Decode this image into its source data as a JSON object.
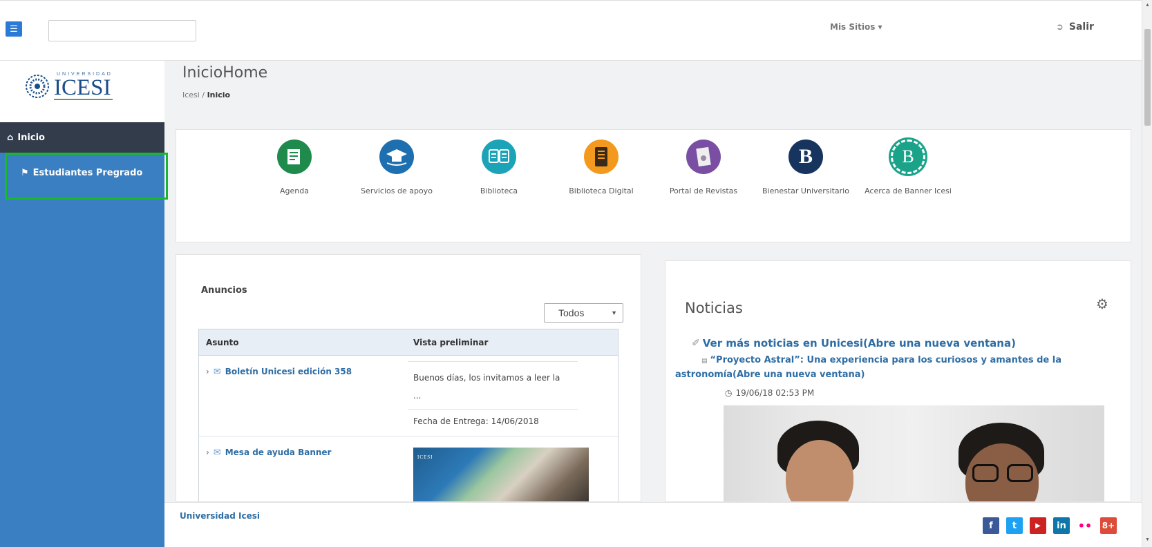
{
  "topbar": {
    "menu_icon": "hamburger-icon",
    "search_placeholder": "",
    "mis_sitios": "Mis Sitios ▾",
    "salir": "Salir"
  },
  "logo": {
    "sub": "UNIVERSIDAD",
    "main": "ICESI"
  },
  "sidebar": {
    "items": [
      {
        "label": "Inicio",
        "icon": "home-icon"
      },
      {
        "label": "Estudiantes Pregrado",
        "icon": "students-icon"
      }
    ]
  },
  "page": {
    "title": "InicioHome",
    "breadcrumb_root": "Icesi",
    "breadcrumb_sep": " / ",
    "breadcrumb_current": "Inicio"
  },
  "apps": [
    {
      "label": "Agenda",
      "icon": "agenda-icon",
      "color": "#1e8a4c"
    },
    {
      "label": "Servicios de apoyo",
      "icon": "graduation-cap-icon",
      "color": "#1e6fb0"
    },
    {
      "label": "Biblioteca",
      "icon": "book-icon",
      "color": "#1ba3b8"
    },
    {
      "label": "Biblioteca Digital",
      "icon": "tablet-icon",
      "color": "#f39a1e"
    },
    {
      "label": "Portal de Revistas",
      "icon": "magazine-icon",
      "color": "#7a4ea3"
    },
    {
      "label": "Bienestar Universitario",
      "icon": "bienestar-b-icon",
      "color": "#16345e"
    },
    {
      "label": "Acerca de Banner Icesi",
      "icon": "banner-b-icon",
      "color": "#1ba38a"
    }
  ],
  "anuncios": {
    "title": "Anuncios",
    "filter": "Todos",
    "headers": [
      "Asunto",
      "Vista preliminar"
    ],
    "rows": [
      {
        "subject": "Boletín Unicesi edición 358",
        "preview": "Buenos días, los invitamos a leer la",
        "ellipsis": "...",
        "date": "Fecha de Entrega: 14/06/2018"
      },
      {
        "subject": "Mesa de ayuda Banner",
        "thumb_logo": "ICESI"
      }
    ]
  },
  "noticias": {
    "title": "Noticias",
    "more_link": "Ver más noticias en Unicesi(Abre una nueva ventana)",
    "item_title": "“Proyecto Astral”: Una experiencia para los curiosos y amantes de la",
    "item_title_cont": "astronomía(Abre una nueva ventana)",
    "item_date": "19/06/18 02:53 PM"
  },
  "footer": {
    "name": "Universidad Icesi",
    "social": [
      {
        "icon": "facebook-icon",
        "glyph": "f",
        "color": "#3b5998"
      },
      {
        "icon": "twitter-icon",
        "glyph": "t",
        "color": "#1da1f2"
      },
      {
        "icon": "youtube-icon",
        "glyph": "▶",
        "color": "#cc2222"
      },
      {
        "icon": "linkedin-icon",
        "glyph": "in",
        "color": "#0e76a8"
      },
      {
        "icon": "flickr-icon",
        "glyph": "••",
        "color": "#ffffff"
      },
      {
        "icon": "googleplus-icon",
        "glyph": "8+",
        "color": "#dd4b39"
      }
    ]
  }
}
